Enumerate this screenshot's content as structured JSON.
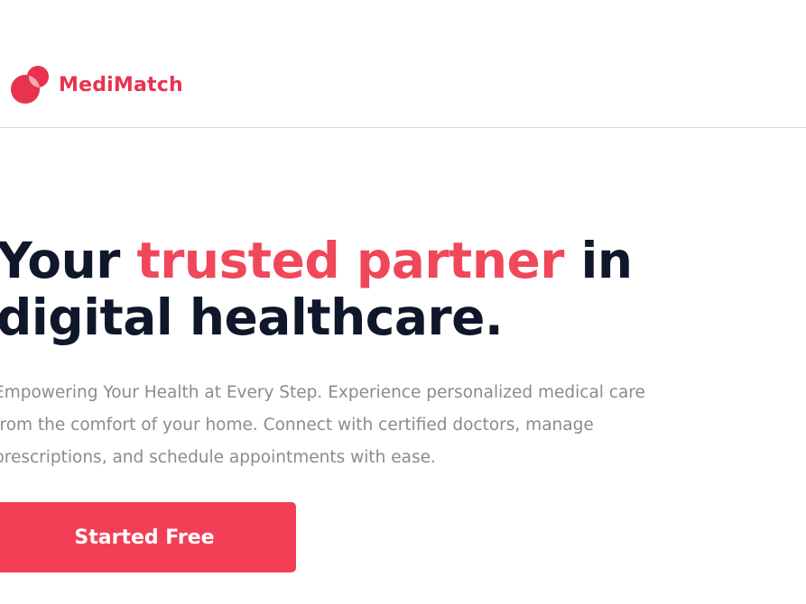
{
  "header": {
    "brand_name": "MediMatch",
    "logo_icon": "overlapping-circles-logo-icon"
  },
  "hero": {
    "headline_before": "Your ",
    "headline_accent": "trusted partner",
    "headline_after_line1": " in",
    "headline_line2": "digital healthcare.",
    "subtext_line1": "Empowering Your Health at Every Step. Experience personalized medical care",
    "subtext_line2": "from the comfort of your home. Connect with certified doctors, manage",
    "subtext_line3": "prescriptions, and schedule appointments with ease.",
    "cta_label": "Started Free"
  },
  "colors": {
    "brand": "#e8334f",
    "accent": "#f0475a",
    "cta_background": "#f23f55",
    "headline": "#0f172a",
    "subtext": "#8b8b8b",
    "divider": "#d9d9d9"
  }
}
